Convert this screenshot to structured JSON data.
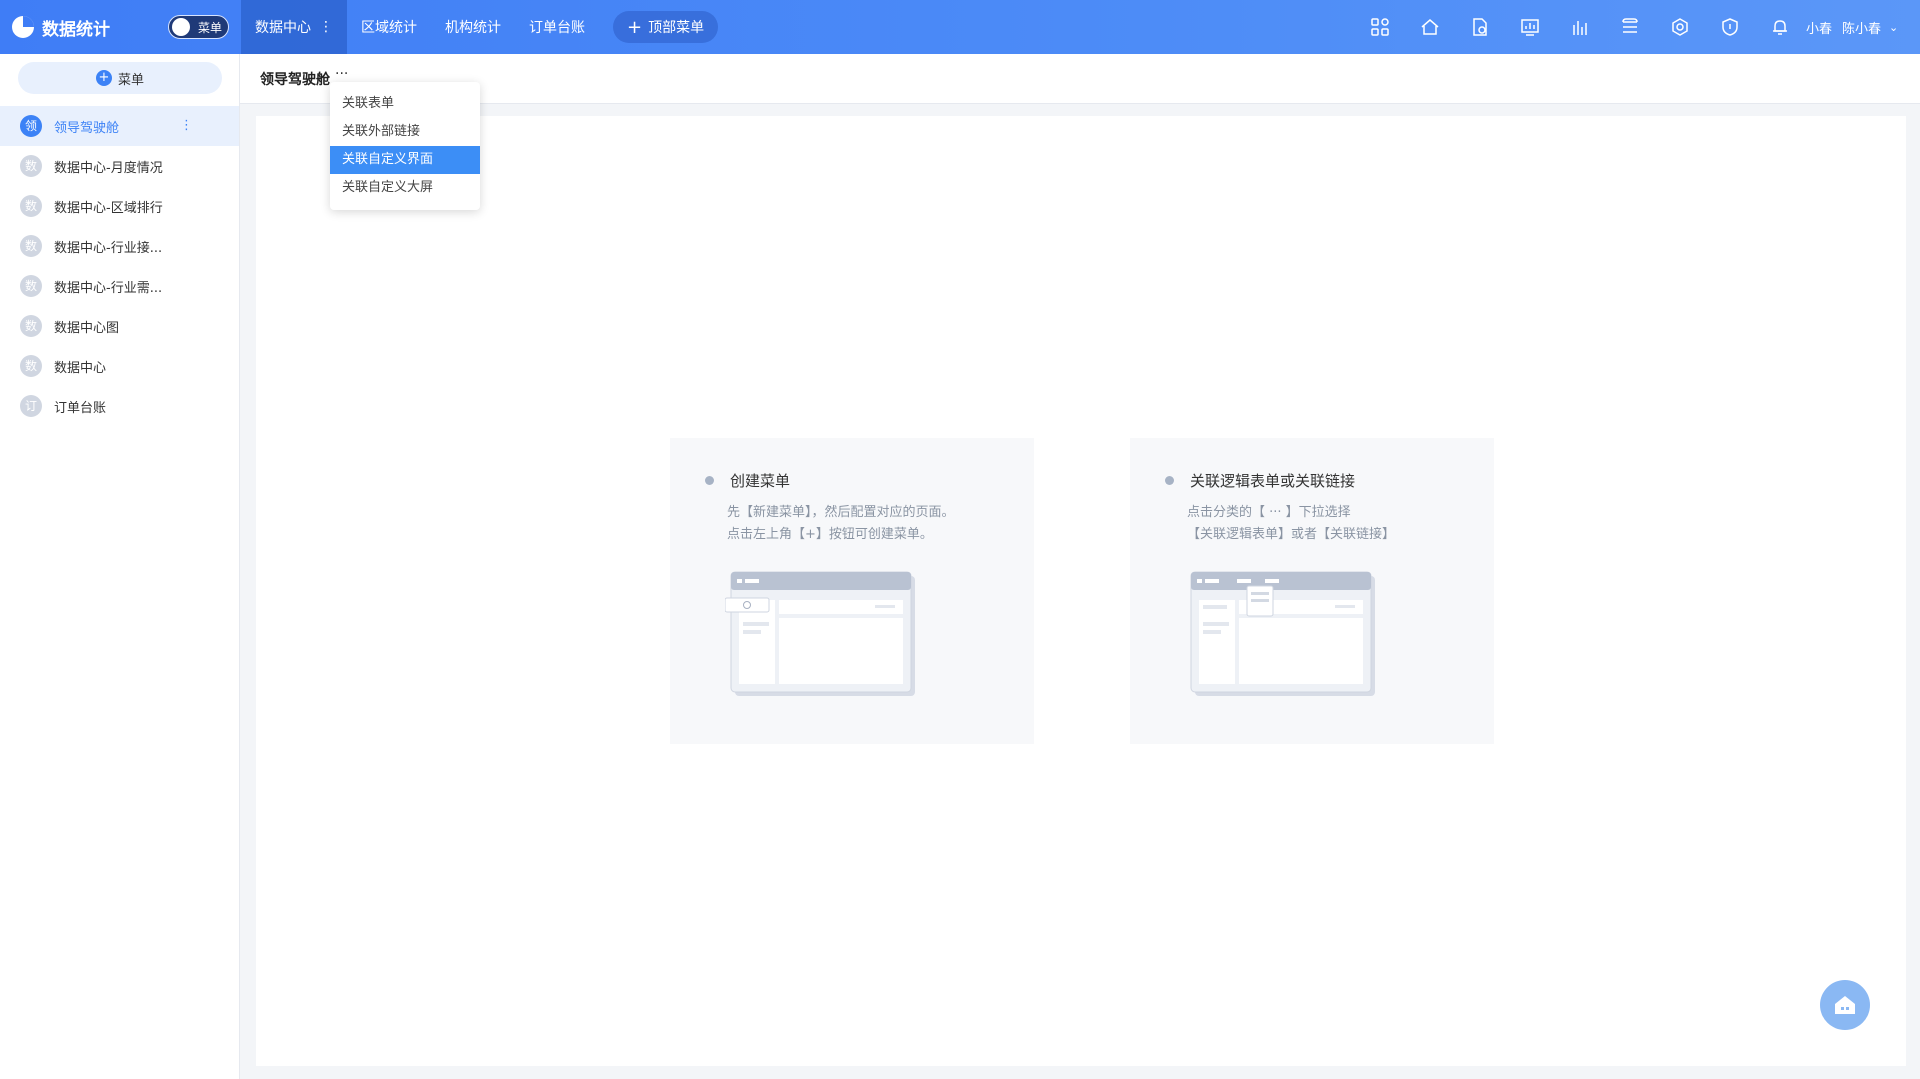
{
  "app": {
    "title": "数据统计"
  },
  "toggle": {
    "label": "菜单"
  },
  "nav": {
    "items": [
      {
        "label": "数据中心",
        "more": "⋮"
      },
      {
        "label": "区域统计"
      },
      {
        "label": "机构统计"
      },
      {
        "label": "订单台账"
      }
    ],
    "add_label": "顶部菜单"
  },
  "top_icons": [
    "apps-icon",
    "home-icon",
    "file-settings-icon",
    "monitor-chart-icon",
    "bar-chart-icon",
    "database-icon",
    "hexagon-settings-icon",
    "shield-icon",
    "bell-icon"
  ],
  "user": {
    "alias": "小春",
    "name": "陈小春"
  },
  "sidebar": {
    "add_label": "菜单",
    "items": [
      {
        "badge": "领",
        "label": "领导驾驶舱",
        "more": "⋮"
      },
      {
        "badge": "数",
        "label": "数据中心-月度情况"
      },
      {
        "badge": "数",
        "label": "数据中心-区域排行"
      },
      {
        "badge": "数",
        "label": "数据中心-行业接..."
      },
      {
        "badge": "数",
        "label": "数据中心-行业需..."
      },
      {
        "badge": "数",
        "label": "数据中心图"
      },
      {
        "badge": "数",
        "label": "数据中心"
      },
      {
        "badge": "订",
        "label": "订单台账"
      }
    ]
  },
  "crumb": {
    "title": "领导驾驶舱",
    "more": "···"
  },
  "dropdown": {
    "items": [
      "关联表单",
      "关联外部链接",
      "关联自定义界面",
      "关联自定义大屏"
    ],
    "active_index": 2
  },
  "cards": [
    {
      "title": "创建菜单",
      "desc": [
        "先【新建菜单】，然后配置对应的页面。",
        "点击左上角【+】按钮可创建菜单。"
      ]
    },
    {
      "title": "关联逻辑表单或关联链接",
      "desc": [
        "点击分类的【 ··· 】下拉选择",
        "【关联逻辑表单】或者【关联链接】"
      ]
    }
  ],
  "colors": {
    "primary": "#3c82f6",
    "topbar": "#4a88f7",
    "active_dropdown": "#3c8ef6"
  }
}
